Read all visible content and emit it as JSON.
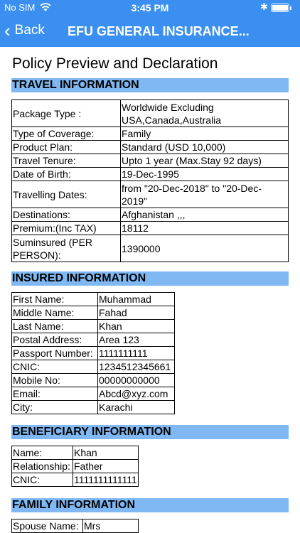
{
  "status_bar": {
    "carrier": "No SIM",
    "time": "3:45 PM",
    "bluetooth": "✱"
  },
  "nav": {
    "back_label": "Back",
    "title": "EFU GENERAL INSURANCE..."
  },
  "page_title": "Policy Preview and Declaration",
  "travel": {
    "header": "TRAVEL INFORMATION",
    "rows": [
      {
        "label": "Package Type :",
        "value": "Worldwide Excluding USA,Canada,Australia"
      },
      {
        "label": "Type of Coverage:",
        "value": "Family"
      },
      {
        "label": "Product Plan:",
        "value": "Standard (USD 10,000)"
      },
      {
        "label": "Travel Tenure:",
        "value": "Upto 1 year (Max.Stay 92 days)"
      },
      {
        "label": "Date of Birth:",
        "value": "19-Dec-1995"
      },
      {
        "label": "Travelling Dates:",
        "value": "from \"20-Dec-2018\" to \"20-Dec-2019\""
      },
      {
        "label": "Destinations:",
        "value": "Afghanistan ,,,"
      },
      {
        "label": "Premium:(Inc TAX)",
        "value": "18112"
      },
      {
        "label": "Suminsured (PER PERSON):",
        "value": "1390000"
      }
    ]
  },
  "insured": {
    "header": "INSURED INFORMATION",
    "rows": [
      {
        "label": "First Name:",
        "value": "Muhammad"
      },
      {
        "label": "Middle Name:",
        "value": "Fahad"
      },
      {
        "label": "Last Name:",
        "value": "Khan"
      },
      {
        "label": "Postal Address:",
        "value": "Area 123"
      },
      {
        "label": "Passport Number:",
        "value": "1111111111"
      },
      {
        "label": "CNIC:",
        "value": "1234512345661"
      },
      {
        "label": "Mobile No:",
        "value": "00000000000"
      },
      {
        "label": "Email:",
        "value": "Abcd@xyz.com"
      },
      {
        "label": "City:",
        "value": "Karachi"
      }
    ]
  },
  "beneficiary": {
    "header": "BENEFICIARY INFORMATION",
    "rows": [
      {
        "label": "Name:",
        "value": "Khan"
      },
      {
        "label": "Relationship:",
        "value": "Father"
      },
      {
        "label": "CNIC:",
        "value": "1111111111111"
      }
    ]
  },
  "family": {
    "header": "FAMILY INFORMATION",
    "rows": [
      {
        "label": "Spouse Name:",
        "value": "Mrs"
      }
    ]
  }
}
